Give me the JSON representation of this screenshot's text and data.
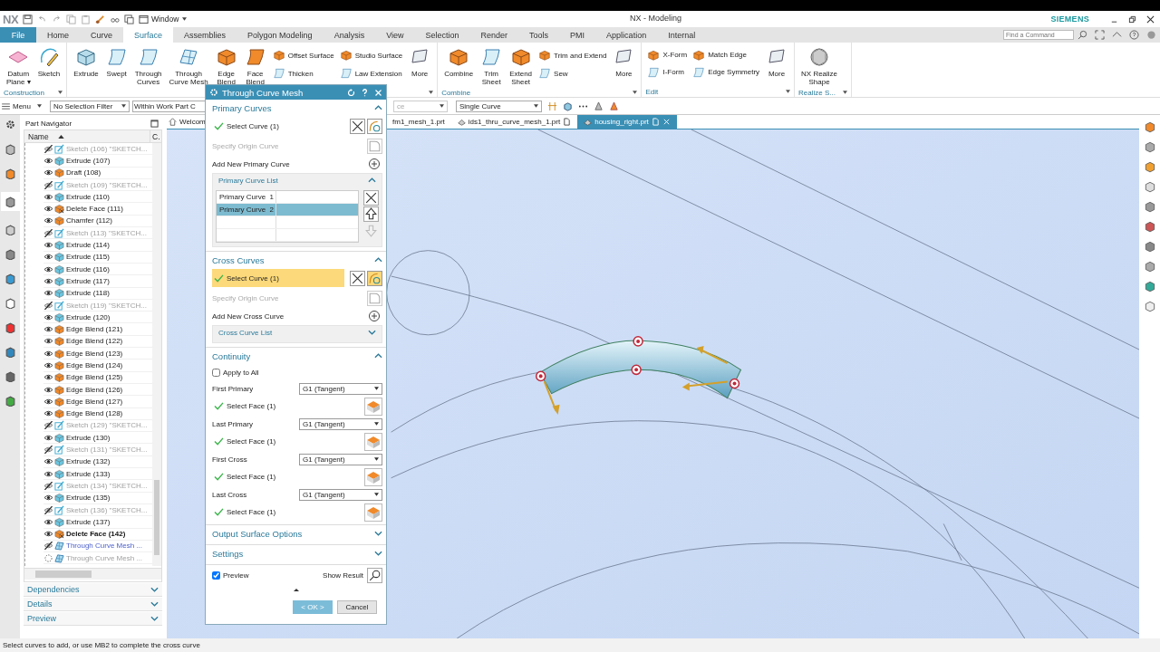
{
  "title_bar": {
    "logo": "NX",
    "window_menu": "Window",
    "title": "NX - Modeling",
    "brand": "SIEMENS"
  },
  "ribbon_tabs": [
    {
      "label": "File",
      "kind": "file",
      "selected": false
    },
    {
      "label": "Home",
      "kind": "tab",
      "selected": false
    },
    {
      "label": "Curve",
      "kind": "tab",
      "selected": false
    },
    {
      "label": "Surface",
      "kind": "tab",
      "selected": true
    },
    {
      "label": "Assemblies",
      "kind": "tab",
      "selected": false
    },
    {
      "label": "Polygon Modeling",
      "kind": "tab",
      "selected": false
    },
    {
      "label": "Analysis",
      "kind": "tab",
      "selected": false
    },
    {
      "label": "View",
      "kind": "tab",
      "selected": false
    },
    {
      "label": "Selection",
      "kind": "tab",
      "selected": false
    },
    {
      "label": "Render",
      "kind": "tab",
      "selected": false
    },
    {
      "label": "Tools",
      "kind": "tab",
      "selected": false
    },
    {
      "label": "PMI",
      "kind": "tab",
      "selected": false
    },
    {
      "label": "Application",
      "kind": "tab",
      "selected": false
    },
    {
      "label": "Internal",
      "kind": "tab",
      "selected": false
    }
  ],
  "command_search": {
    "placeholder": "Find a Command"
  },
  "ribbon_groups": [
    {
      "label": "Construction",
      "items": [
        {
          "kind": "large",
          "lines": [
            "Datum",
            "Plane ▾"
          ]
        },
        {
          "kind": "large",
          "lines": [
            "Sketch"
          ]
        }
      ]
    },
    {
      "items": [
        {
          "kind": "large",
          "lines": [
            "Extrude"
          ]
        },
        {
          "kind": "large",
          "lines": [
            "Swept"
          ]
        },
        {
          "kind": "large",
          "lines": [
            "Through",
            "Curves"
          ]
        },
        {
          "kind": "large",
          "lines": [
            "Through",
            "Curve Mesh"
          ]
        },
        {
          "kind": "large",
          "lines": [
            "Edge",
            "Blend"
          ]
        },
        {
          "kind": "large",
          "lines": [
            "Face",
            "Blend"
          ]
        },
        {
          "kind": "stack",
          "labels": [
            "Offset Surface",
            "Thicken"
          ]
        },
        {
          "kind": "stack",
          "labels": [
            "Studio Surface",
            "Law Extension"
          ]
        },
        {
          "kind": "large",
          "lines": [
            "More"
          ]
        }
      ]
    },
    {
      "label": "Combine",
      "items": [
        {
          "kind": "large",
          "lines": [
            "Combine"
          ]
        },
        {
          "kind": "large",
          "lines": [
            "Trim",
            "Sheet"
          ]
        },
        {
          "kind": "large",
          "lines": [
            "Extend",
            "Sheet"
          ]
        },
        {
          "kind": "stack",
          "labels": [
            "Trim and Extend",
            "Sew"
          ]
        },
        {
          "kind": "large",
          "lines": [
            "More"
          ]
        }
      ]
    },
    {
      "label": "Edit",
      "items": [
        {
          "kind": "stack",
          "labels": [
            "X-Form",
            "I-Form"
          ]
        },
        {
          "kind": "stack",
          "labels": [
            "Match Edge",
            "Edge Symmetry"
          ]
        },
        {
          "kind": "large",
          "lines": [
            "More"
          ]
        }
      ]
    },
    {
      "label": "Realize S...",
      "items": [
        {
          "kind": "large",
          "lines": [
            "NX Realize",
            "Shape"
          ]
        }
      ]
    }
  ],
  "selection_bar": {
    "menu": "Menu",
    "dropdowns": [
      {
        "value": "No Selection Filter",
        "disabled": false
      },
      {
        "value": "Within Work Part C",
        "disabled": false
      },
      {
        "value": "ce",
        "disabled": true
      },
      {
        "value": "Single Curve",
        "disabled": false
      }
    ]
  },
  "part_navigator": {
    "title": "Part Navigator",
    "columns": [
      "Name",
      "C."
    ],
    "rows": [
      {
        "label": "Sketch (106) \"SKETCH...",
        "kind": "sketch",
        "hidden": true,
        "greyed": true,
        "current": false,
        "highlighted": false,
        "preview": false
      },
      {
        "label": "Extrude (107)",
        "kind": "extrude",
        "hidden": false,
        "greyed": false,
        "current": false,
        "highlighted": false,
        "preview": false
      },
      {
        "label": "Draft (108)",
        "kind": "solid",
        "hidden": false,
        "greyed": false,
        "current": false,
        "highlighted": false,
        "preview": false
      },
      {
        "label": "Sketch (109) \"SKETCH...",
        "kind": "sketch",
        "hidden": true,
        "greyed": true,
        "current": false,
        "highlighted": false,
        "preview": false
      },
      {
        "label": "Extrude (110)",
        "kind": "extrude",
        "hidden": false,
        "greyed": false,
        "current": false,
        "highlighted": false,
        "preview": false
      },
      {
        "label": "Delete Face (111)",
        "kind": "delete",
        "hidden": false,
        "greyed": false,
        "current": false,
        "highlighted": false,
        "preview": false
      },
      {
        "label": "Chamfer (112)",
        "kind": "solid",
        "hidden": false,
        "greyed": false,
        "current": false,
        "highlighted": false,
        "preview": false
      },
      {
        "label": "Sketch (113) \"SKETCH...",
        "kind": "sketch",
        "hidden": true,
        "greyed": true,
        "current": false,
        "highlighted": false,
        "preview": false
      },
      {
        "label": "Extrude (114)",
        "kind": "extrude",
        "hidden": false,
        "greyed": false,
        "current": false,
        "highlighted": false,
        "preview": false
      },
      {
        "label": "Extrude (115)",
        "kind": "extrude",
        "hidden": false,
        "greyed": false,
        "current": false,
        "highlighted": false,
        "preview": false
      },
      {
        "label": "Extrude (116)",
        "kind": "extrude",
        "hidden": false,
        "greyed": false,
        "current": false,
        "highlighted": false,
        "preview": false
      },
      {
        "label": "Extrude (117)",
        "kind": "extrude",
        "hidden": false,
        "greyed": false,
        "current": false,
        "highlighted": false,
        "preview": false
      },
      {
        "label": "Extrude (118)",
        "kind": "extrude",
        "hidden": false,
        "greyed": false,
        "current": false,
        "highlighted": false,
        "preview": false
      },
      {
        "label": "Sketch (119) \"SKETCH...",
        "kind": "sketch",
        "hidden": true,
        "greyed": true,
        "current": false,
        "highlighted": false,
        "preview": false
      },
      {
        "label": "Extrude (120)",
        "kind": "extrude",
        "hidden": false,
        "greyed": false,
        "current": false,
        "highlighted": false,
        "preview": false
      },
      {
        "label": "Edge Blend (121)",
        "kind": "solid",
        "hidden": false,
        "greyed": false,
        "current": false,
        "highlighted": false,
        "preview": false
      },
      {
        "label": "Edge Blend (122)",
        "kind": "solid",
        "hidden": false,
        "greyed": false,
        "current": false,
        "highlighted": false,
        "preview": false
      },
      {
        "label": "Edge Blend (123)",
        "kind": "solid",
        "hidden": false,
        "greyed": false,
        "current": false,
        "highlighted": false,
        "preview": false
      },
      {
        "label": "Edge Blend (124)",
        "kind": "solid",
        "hidden": false,
        "greyed": false,
        "current": false,
        "highlighted": false,
        "preview": false
      },
      {
        "label": "Edge Blend (125)",
        "kind": "solid",
        "hidden": false,
        "greyed": false,
        "current": false,
        "highlighted": false,
        "preview": false
      },
      {
        "label": "Edge Blend (126)",
        "kind": "solid",
        "hidden": false,
        "greyed": false,
        "current": false,
        "highlighted": false,
        "preview": false
      },
      {
        "label": "Edge Blend (127)",
        "kind": "solid",
        "hidden": false,
        "greyed": false,
        "current": false,
        "highlighted": false,
        "preview": false
      },
      {
        "label": "Edge Blend (128)",
        "kind": "solid",
        "hidden": false,
        "greyed": false,
        "current": false,
        "highlighted": false,
        "preview": false
      },
      {
        "label": "Sketch (129) \"SKETCH...",
        "kind": "sketch",
        "hidden": true,
        "greyed": true,
        "current": false,
        "highlighted": false,
        "preview": false
      },
      {
        "label": "Extrude (130)",
        "kind": "extrude",
        "hidden": false,
        "greyed": false,
        "current": false,
        "highlighted": false,
        "preview": false
      },
      {
        "label": "Sketch (131) \"SKETCH...",
        "kind": "sketch",
        "hidden": true,
        "greyed": true,
        "current": false,
        "highlighted": false,
        "preview": false
      },
      {
        "label": "Extrude (132)",
        "kind": "extrude",
        "hidden": false,
        "greyed": false,
        "current": false,
        "highlighted": false,
        "preview": false
      },
      {
        "label": "Extrude (133)",
        "kind": "extrude",
        "hidden": false,
        "greyed": false,
        "current": false,
        "highlighted": false,
        "preview": false
      },
      {
        "label": "Sketch (134) \"SKETCH...",
        "kind": "sketch",
        "hidden": true,
        "greyed": true,
        "current": false,
        "highlighted": false,
        "preview": false
      },
      {
        "label": "Extrude (135)",
        "kind": "extrude",
        "hidden": false,
        "greyed": false,
        "current": false,
        "highlighted": false,
        "preview": false
      },
      {
        "label": "Sketch (136) \"SKETCH...",
        "kind": "sketch",
        "hidden": true,
        "greyed": true,
        "current": false,
        "highlighted": false,
        "preview": false
      },
      {
        "label": "Extrude (137)",
        "kind": "extrude",
        "hidden": false,
        "greyed": false,
        "current": false,
        "highlighted": false,
        "preview": false
      },
      {
        "label": "Delete Face (142)",
        "kind": "delete",
        "hidden": false,
        "greyed": false,
        "current": true,
        "highlighted": false,
        "preview": false
      },
      {
        "label": "Through Curve Mesh ...",
        "kind": "mesh",
        "hidden": true,
        "greyed": false,
        "current": false,
        "highlighted": true,
        "preview": false
      },
      {
        "label": "Through Curve Mesh ...",
        "kind": "mesh",
        "hidden": false,
        "greyed": true,
        "current": false,
        "highlighted": false,
        "preview": true
      }
    ],
    "panels": [
      {
        "title": "Dependencies",
        "expanded": false
      },
      {
        "title": "Details",
        "expanded": false
      },
      {
        "title": "Preview",
        "expanded": false
      }
    ]
  },
  "viewport_tabs": [
    {
      "label": "Welcom",
      "kind": "home",
      "selected": false
    },
    {
      "label": "fm1_mesh_1.prt",
      "kind": "part",
      "selected": false
    },
    {
      "label": "ids1_thru_curve_mesh_1.prt",
      "kind": "part",
      "selected": false
    },
    {
      "label": "housing_right.prt",
      "kind": "part",
      "selected": true
    }
  ],
  "dialog": {
    "title": "Through Curve Mesh",
    "sections": [
      {
        "title": "Primary Curves",
        "expanded": true,
        "rows": [
          {
            "kind": "select",
            "label": "Select Curve (1)",
            "done": true,
            "highlighted": false
          },
          {
            "kind": "origin",
            "label": "Specify Origin Curve"
          },
          {
            "kind": "add",
            "label": "Add New Primary Curve"
          },
          {
            "kind": "list",
            "title": "Primary Curve List",
            "expanded": true,
            "items": [
              {
                "label": "Primary Curve  1",
                "selected": false
              },
              {
                "label": "Primary Curve  2",
                "selected": true
              }
            ]
          }
        ]
      },
      {
        "title": "Cross Curves",
        "expanded": true,
        "rows": [
          {
            "kind": "select",
            "label": "Select Curve (1)",
            "done": true,
            "highlighted": true
          },
          {
            "kind": "origin",
            "label": "Specify Origin Curve"
          },
          {
            "kind": "add",
            "label": "Add New Cross Curve"
          },
          {
            "kind": "list",
            "title": "Cross Curve List",
            "expanded": false,
            "items": []
          }
        ]
      },
      {
        "title": "Continuity",
        "expanded": true,
        "rows": [
          {
            "kind": "checkbox",
            "label": "Apply to All",
            "checked": false
          },
          {
            "kind": "dropdown",
            "label": "First Primary",
            "value": "G1 (Tangent)"
          },
          {
            "kind": "face",
            "label": "Select Face (1)",
            "done": true
          },
          {
            "kind": "dropdown",
            "label": "Last Primary",
            "value": "G1 (Tangent)"
          },
          {
            "kind": "face",
            "label": "Select Face (1)",
            "done": true
          },
          {
            "kind": "dropdown",
            "label": "First Cross",
            "value": "G1 (Tangent)"
          },
          {
            "kind": "face",
            "label": "Select Face (1)",
            "done": true
          },
          {
            "kind": "dropdown",
            "label": "Last Cross",
            "value": "G1 (Tangent)"
          },
          {
            "kind": "face",
            "label": "Select Face (1)",
            "done": true
          }
        ]
      },
      {
        "title": "Output Surface Options",
        "expanded": false
      },
      {
        "title": "Settings",
        "expanded": false
      }
    ],
    "preview": {
      "label": "Preview",
      "checked": true
    },
    "show_result": "Show Result",
    "ok": "< OK >",
    "cancel": "Cancel"
  },
  "status_bar": {
    "message": "Select curves to add, or use MB2 to complete the cross curve"
  }
}
